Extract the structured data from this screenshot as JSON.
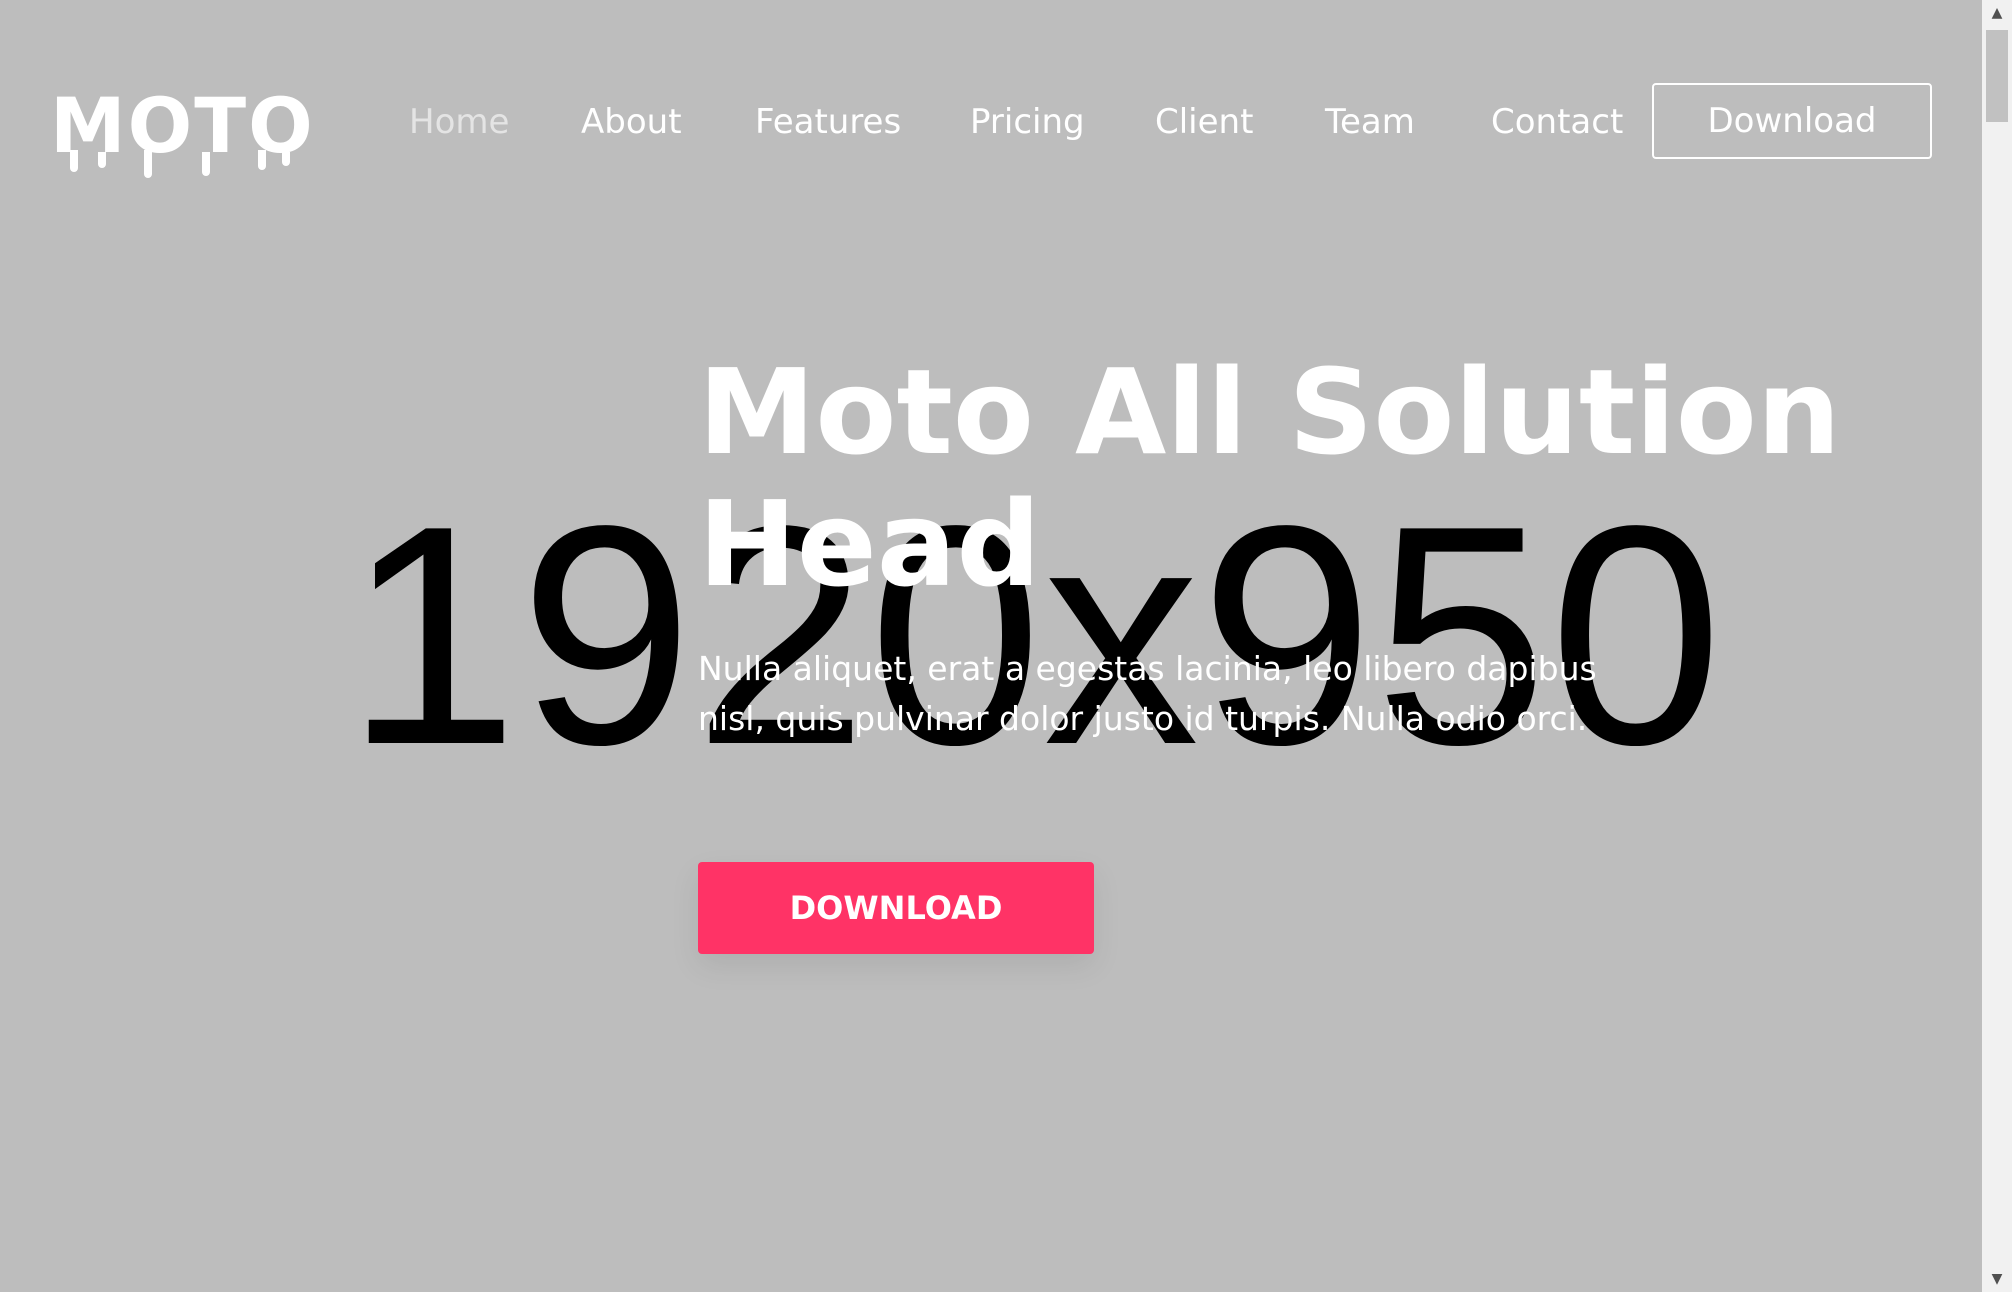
{
  "placeholder": {
    "text": "1920x950"
  },
  "header": {
    "logo": "MOTO",
    "nav": [
      {
        "label": "Home",
        "active": true
      },
      {
        "label": "About",
        "active": false
      },
      {
        "label": "Features",
        "active": false
      },
      {
        "label": "Pricing",
        "active": false
      },
      {
        "label": "Client",
        "active": false
      },
      {
        "label": "Team",
        "active": false
      },
      {
        "label": "Contact",
        "active": false
      }
    ],
    "download_label": "Download"
  },
  "hero": {
    "title": "Moto All Solution Head",
    "text": "Nulla aliquet, erat a egestas lacinia, leo libero dapibus nisl, quis pulvinar dolor justo id turpis. Nulla odio orci.",
    "button_label": "DOWNLOAD"
  },
  "colors": {
    "background": "#bdbdbd",
    "accent": "#ff3366",
    "text": "#ffffff"
  },
  "scrollbar": {
    "up_icon": "triangle-up-icon",
    "down_icon": "triangle-down-icon"
  }
}
